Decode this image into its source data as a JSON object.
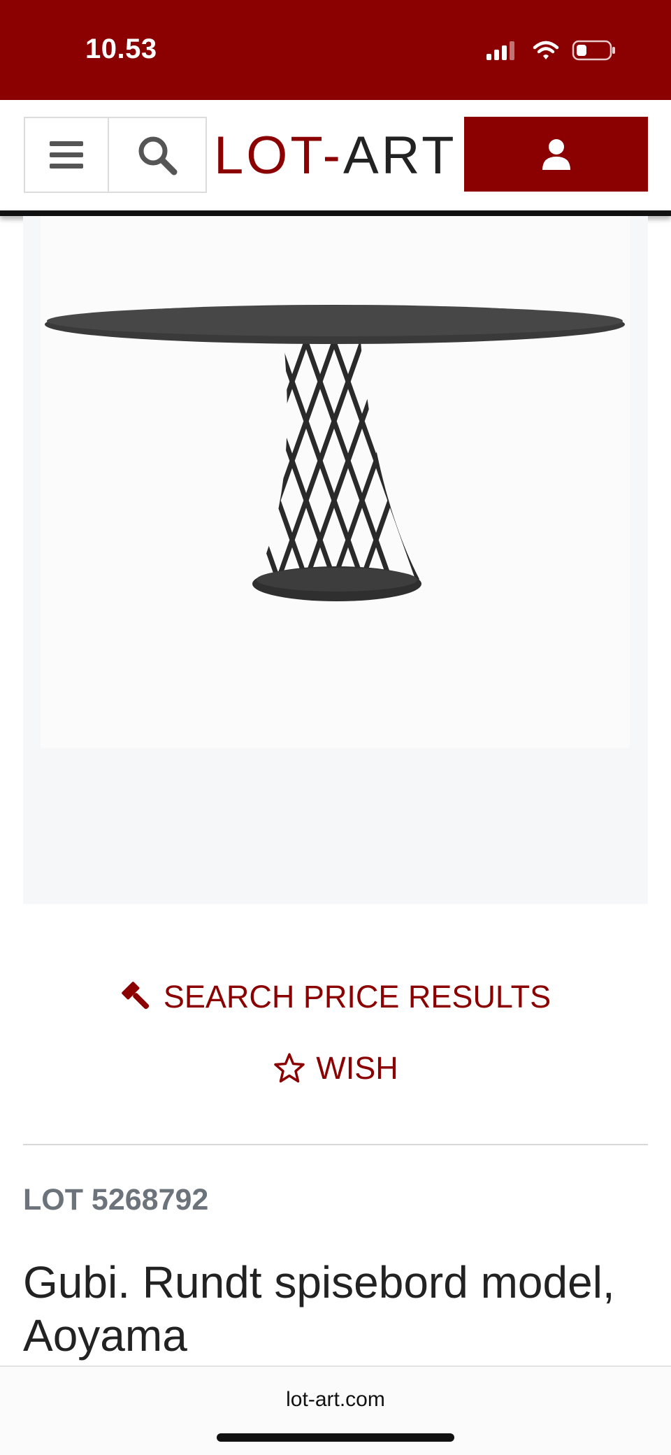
{
  "status_bar": {
    "time": "10.53"
  },
  "header": {
    "logo_left": "LOT",
    "logo_dash": "-",
    "logo_right": "ART",
    "menu_icon": "hamburger-icon",
    "search_icon": "search-icon",
    "account_icon": "user-icon",
    "brand_color": "#8b0000"
  },
  "product": {
    "image_alt": "round dining table with lattice base",
    "search_price_label": "SEARCH PRICE RESULTS",
    "wish_label": "WISH",
    "lot_number": "LOT 5268792",
    "title": "Gubi. Rundt spisebord model, Aoyama"
  },
  "browser": {
    "url": "lot-art.com"
  }
}
